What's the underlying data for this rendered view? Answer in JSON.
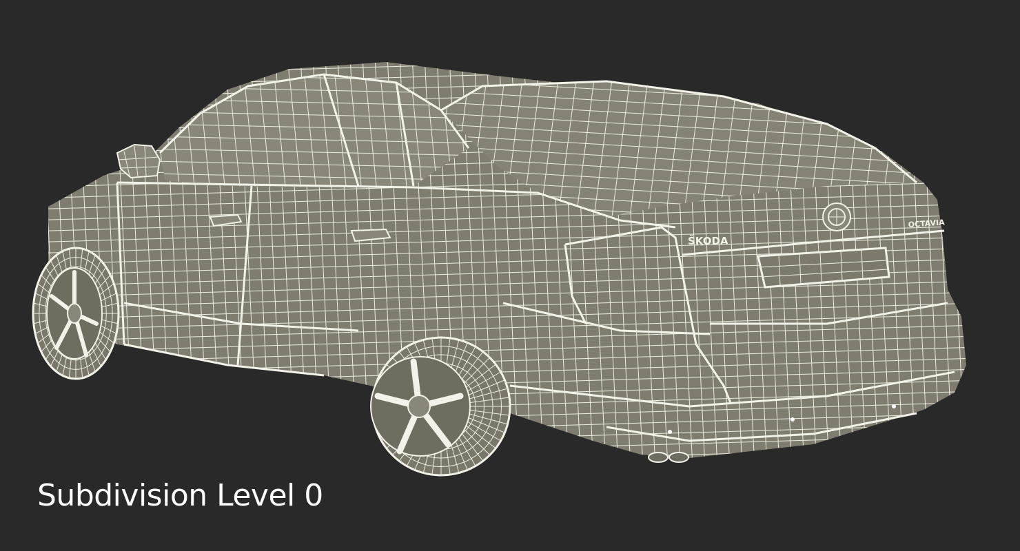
{
  "caption": "Subdivision Level 0",
  "badges": {
    "brand": "ŠKODA",
    "model": "OCTAVIA"
  },
  "colors": {
    "background": "#292929",
    "body_fill": "#807d70",
    "wire": "#efeee2",
    "caption": "#ffffff"
  }
}
